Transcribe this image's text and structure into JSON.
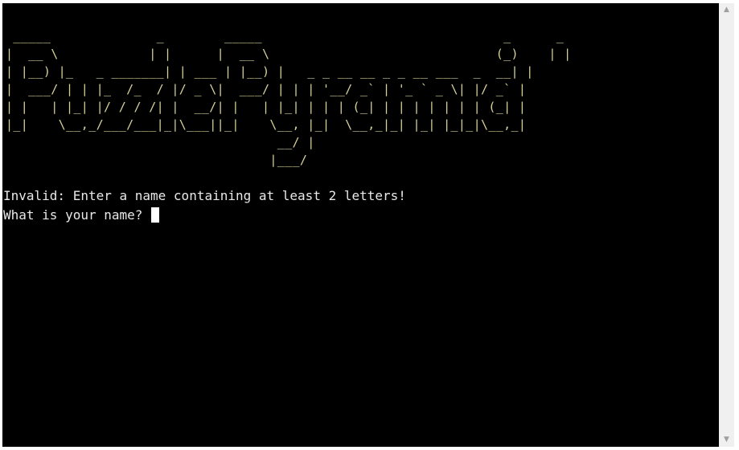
{
  "terminal": {
    "banner_lines": [
      " _____              _        _____                                _      _ ",
      "|  __ \\            | |      |  __ \\                              (_)    | |",
      "| |__) |_   _ _______| | ___ | |__) |   _ _ __ __ _ _ __ ___  _  __| |",
      "|  ___/ | | |_  /_  / |/ _ \\|  ___/ | | | '__/ _` | '_ ` _ \\| |/ _` |",
      "| |   | |_| |/ / / /| |  __/| |   | |_| | | | (_| | | | | | | | (_| |",
      "|_|    \\__,_/___/___|_|\\___||_|    \\__, |_|  \\__,_|_| |_| |_|_|\\__,_|",
      "                                    __/ |                            ",
      "                                   |___/                             "
    ],
    "error_text": "Invalid: Enter a name containing at least 2 letters!",
    "prompt_text": "What is your name? ",
    "banner_color": "#d7d29a",
    "text_color": "#e8e8e8",
    "background_color": "#000000"
  },
  "scrollbar": {
    "up_icon": "▲",
    "down_icon": "▼"
  }
}
